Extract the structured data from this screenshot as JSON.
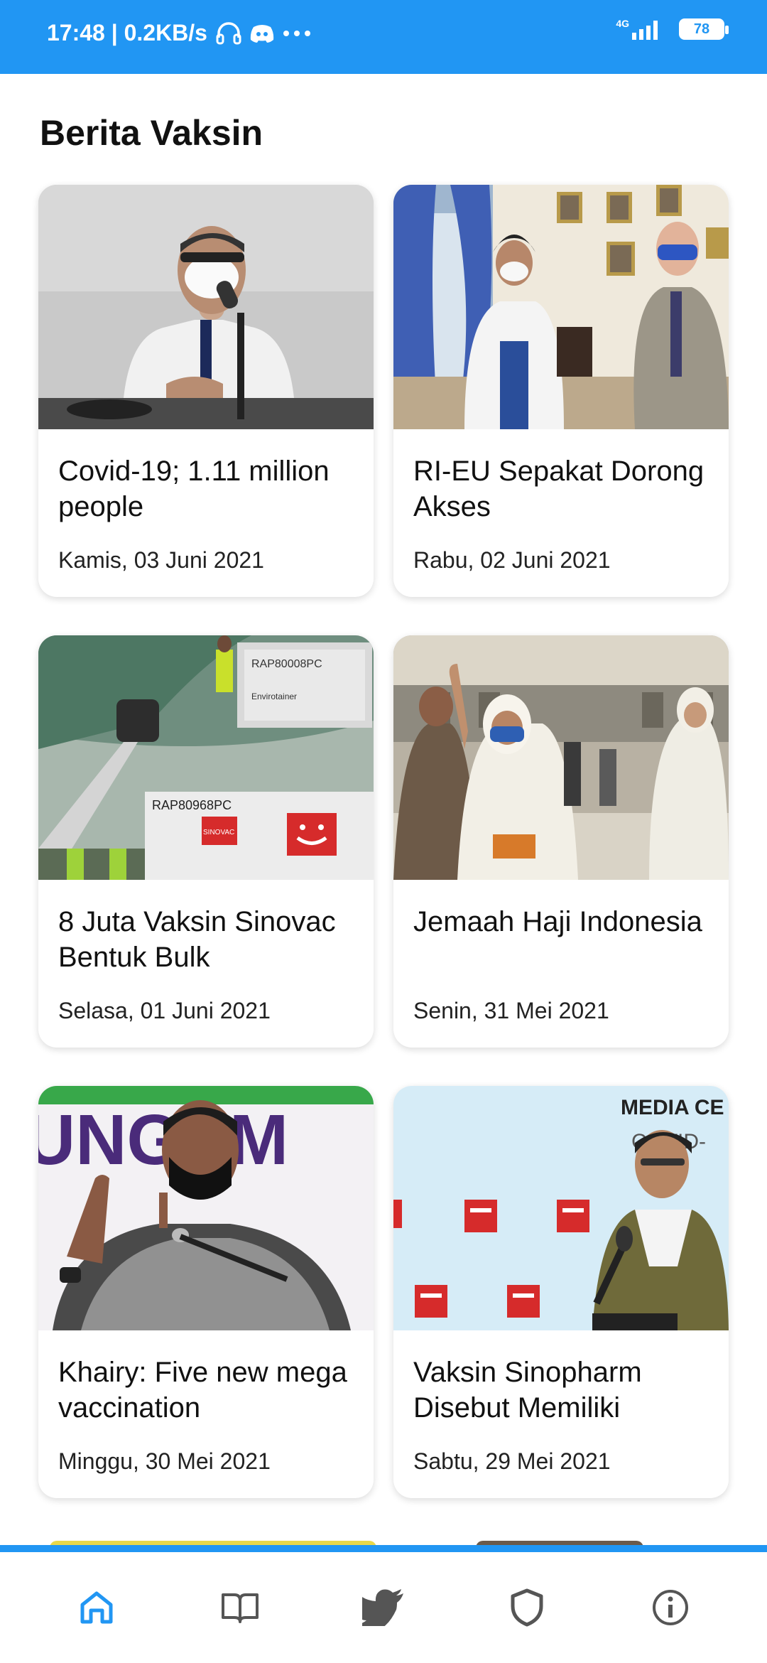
{
  "status_bar": {
    "time_speed": "17:48 | 0.2KB/s",
    "network_label": "4G",
    "battery": "78",
    "icons": [
      "headphones-icon",
      "discord-icon",
      "more-dots-icon",
      "signal-icon",
      "battery-icon"
    ]
  },
  "page": {
    "title": "Berita Vaksin"
  },
  "articles": [
    {
      "title": "Covid-19; 1.11 million people",
      "date": "Kamis, 03 Juni 2021",
      "image": "man-with-mask-at-microphone"
    },
    {
      "title": "RI-EU Sepakat Dorong Akses",
      "date": "Rabu, 02 Juni 2021",
      "image": "officials-in-masks-meeting"
    },
    {
      "title": "8 Juta Vaksin Sinovac Bentuk Bulk",
      "date": "Selasa, 01 Juni 2021",
      "image": "vaccine-cargo-unloading"
    },
    {
      "title": "Jemaah Haji Indonesia",
      "date": "Senin, 31 Mei 2021",
      "image": "pilgrims-at-airport"
    },
    {
      "title": "Khairy: Five new mega vaccination",
      "date": "Minggu, 30 Mei 2021",
      "image": "speaker-at-press-conference"
    },
    {
      "title": "Vaksin Sinopharm Disebut Memiliki",
      "date": "Sabtu, 29 Mei 2021",
      "image": "official-at-media-center"
    }
  ],
  "image_text": {
    "cargo_label_top": "RAP80008PC",
    "cargo_label": "RAP80968PC",
    "cargo_brand": "Envirotainer",
    "cargo_sinovac": "SINOVAC",
    "backdrop_text": "UNGEM",
    "media_center": "MEDIA CE",
    "covid_text": "COVID-"
  },
  "bottom_nav": {
    "items": [
      "home-icon",
      "book-icon",
      "twitter-icon",
      "shield-icon",
      "info-icon"
    ],
    "active_color": "#2196f3",
    "inactive_color": "#555555"
  },
  "colors": {
    "accent": "#2196f3"
  }
}
